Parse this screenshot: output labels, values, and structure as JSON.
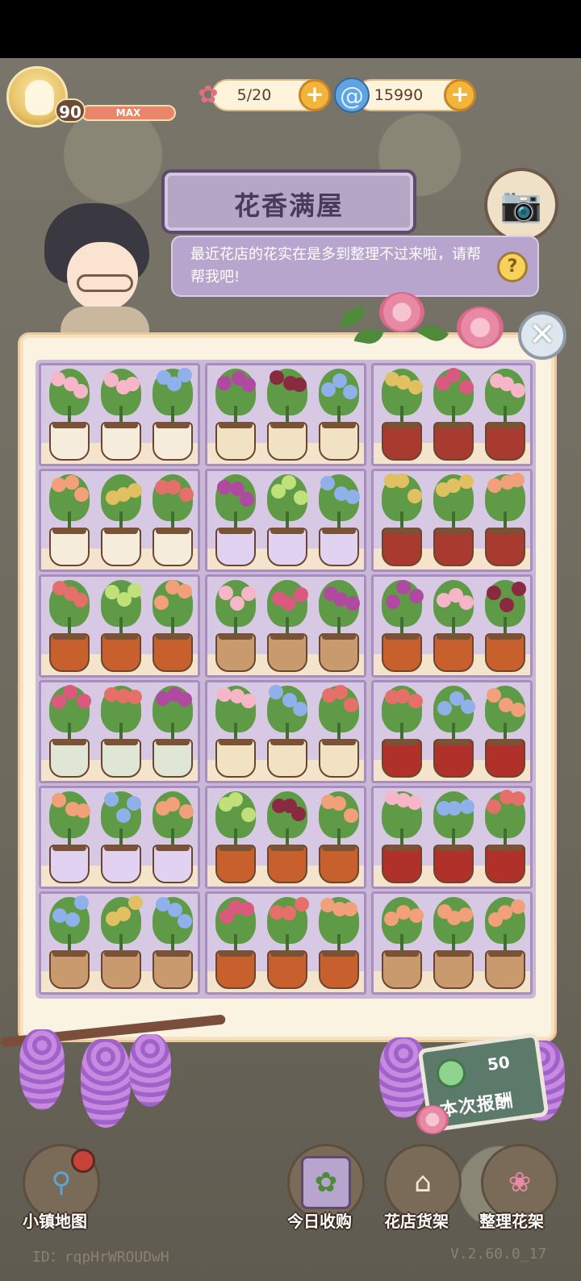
{
  "hud": {
    "level": "90",
    "xp_label": "MAX",
    "flower_count": "5/20",
    "currency": "15990",
    "flower_icon": "flower-icon",
    "currency_icon": "swirl-gem-icon",
    "plus_label": "+"
  },
  "title": "花香满屋",
  "dialog": {
    "text": "最近花店的花实在是多到整理不过来啦，请帮帮我吧!",
    "help_label": "?"
  },
  "close_label": "✕",
  "reward": {
    "amount": "50",
    "label": "本次报酬"
  },
  "nav": {
    "map": "小镇地图",
    "today_purchase": "今日收购",
    "shop_shelf": "花店货架",
    "arrange_shelf": "整理花架"
  },
  "footer": {
    "id": "ID：rqpHrWROUDwH",
    "version": "V.2.60.0_17"
  },
  "colors": {
    "accent_purple": "#b7a5cd",
    "gold": "#f3b43a",
    "panel": "#fbf3e2"
  }
}
